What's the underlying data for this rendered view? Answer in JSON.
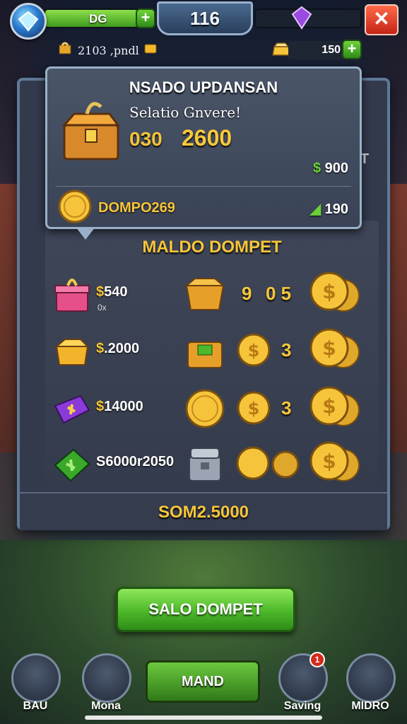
{
  "topbar": {
    "xp_value": "DG",
    "xp_progress": 0.85,
    "level": "116",
    "resource_label": "2103 ,pndl",
    "resource_value": "150",
    "plus": "+",
    "close": "✕"
  },
  "tooltip": {
    "title": "NSADO UPDANSAN",
    "subtitle": "Selatio Gnvere!",
    "value_small": "030",
    "value_big": "2600",
    "price": "900",
    "price_symbol": "$",
    "coin_label": "DOMPO269",
    "count": "190"
  },
  "back_panel": {
    "stub_text": "T"
  },
  "shop": {
    "header": "MALDO DOMPET",
    "rows": [
      {
        "price": "540",
        "price_symbol": "$",
        "sub": "0x",
        "num_a": "9",
        "num_b": "0 5",
        "icon": "pink-gift-box-icon",
        "item2": "open-crate-icon",
        "item3": ""
      },
      {
        "price": ".2000",
        "price_symbol": "$",
        "sub": "",
        "num_a": "",
        "num_b": "3",
        "icon": "gold-box-icon",
        "item2": "green-gem-chest-icon",
        "item3": "gold-coin-icon"
      },
      {
        "price": "14000",
        "price_symbol": "$",
        "sub": "",
        "num_a": "",
        "num_b": "3",
        "icon": "purple-gem-icon",
        "item2": "gold-coin-large-icon",
        "item3": "gold-coin-icon"
      },
      {
        "price": "S6000r2050",
        "price_symbol": "",
        "sub": "",
        "num_a": "",
        "num_b": "",
        "icon": "green-gem-icon",
        "item2": "silver-chest-icon",
        "item3": "gold-coin-pair-icon"
      }
    ],
    "total": "SOM2.5000"
  },
  "buttons": {
    "main": "SALO DOMPET",
    "secondary": "MAND"
  },
  "nav": [
    {
      "label": "BAU"
    },
    {
      "label": "Mona"
    },
    {
      "label": "Saving",
      "badge": "1"
    },
    {
      "label": "MIDRO"
    }
  ],
  "colors": {
    "gold": "#f7c63a",
    "green_button": "#4cb82a",
    "panel": "#3e4658",
    "close_red": "#c42416"
  }
}
